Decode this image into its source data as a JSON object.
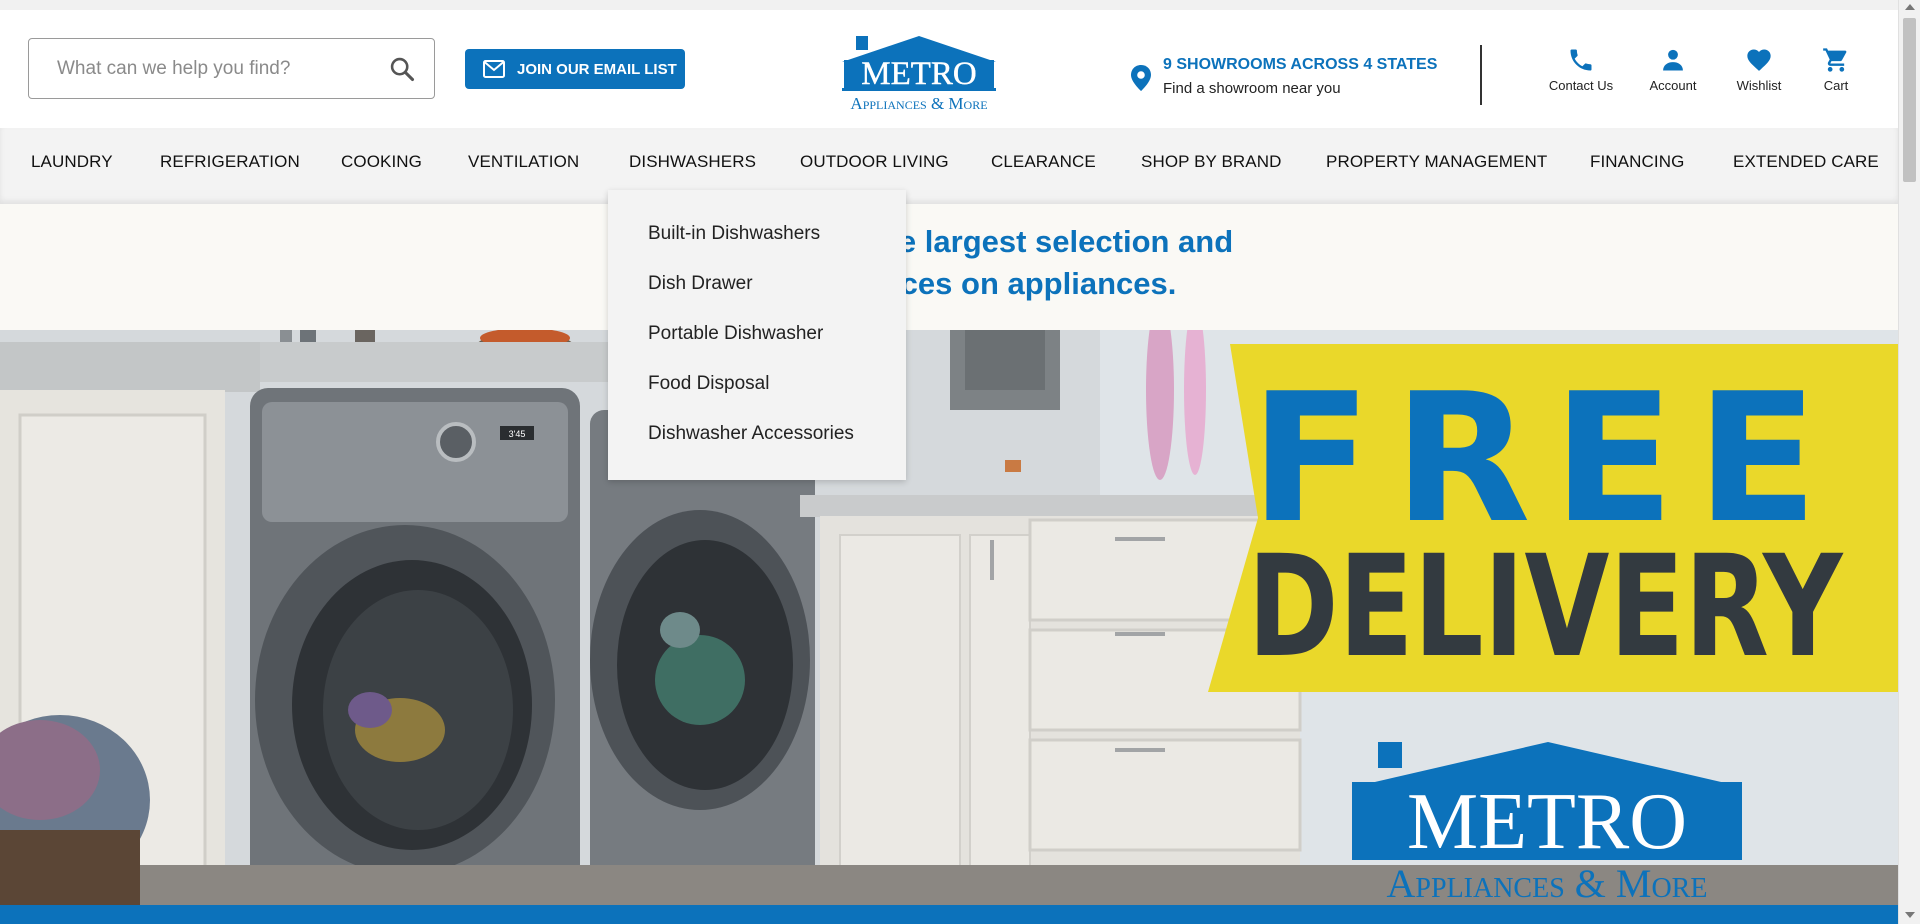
{
  "search": {
    "placeholder": "What can we help you find?"
  },
  "email_button": {
    "label": "JOIN OUR EMAIL LIST"
  },
  "logo": {
    "line1": "METRO",
    "line2": "Appliances & More"
  },
  "showroom": {
    "headline": "9 SHOWROOMS ACROSS 4 STATES",
    "subline": "Find a showroom near you"
  },
  "header_icons": [
    {
      "label": "Contact Us",
      "icon": "phone-icon"
    },
    {
      "label": "Account",
      "icon": "account-icon"
    },
    {
      "label": "Wishlist",
      "icon": "heart-icon"
    },
    {
      "label": "Cart",
      "icon": "cart-icon"
    }
  ],
  "nav": {
    "items": [
      "LAUNDRY",
      "REFRIGERATION",
      "COOKING",
      "VENTILATION",
      "DISHWASHERS",
      "OUTDOOR LIVING",
      "CLEARANCE",
      "SHOP BY BRAND",
      "PROPERTY MANAGEMENT",
      "FINANCING",
      "EXTENDED CARE"
    ]
  },
  "dropdown": {
    "items": [
      "Built-in Dishwashers",
      "Dish Drawer",
      "Portable Dishwasher",
      "Food Disposal",
      "Dishwasher Accessories"
    ]
  },
  "promo": {
    "line1_visible": "he largest selection and",
    "line2_visible": "rices on appliances."
  },
  "hero": {
    "banner_line1": "FREE",
    "banner_line2": "DELIVERY",
    "logo_line1": "METRO",
    "logo_line2": "Appliances & More",
    "washer_display": "3'45"
  },
  "colors": {
    "brand_blue": "#0c72bb",
    "banner_yellow": "#ead82a",
    "dark_text": "#333a40"
  }
}
